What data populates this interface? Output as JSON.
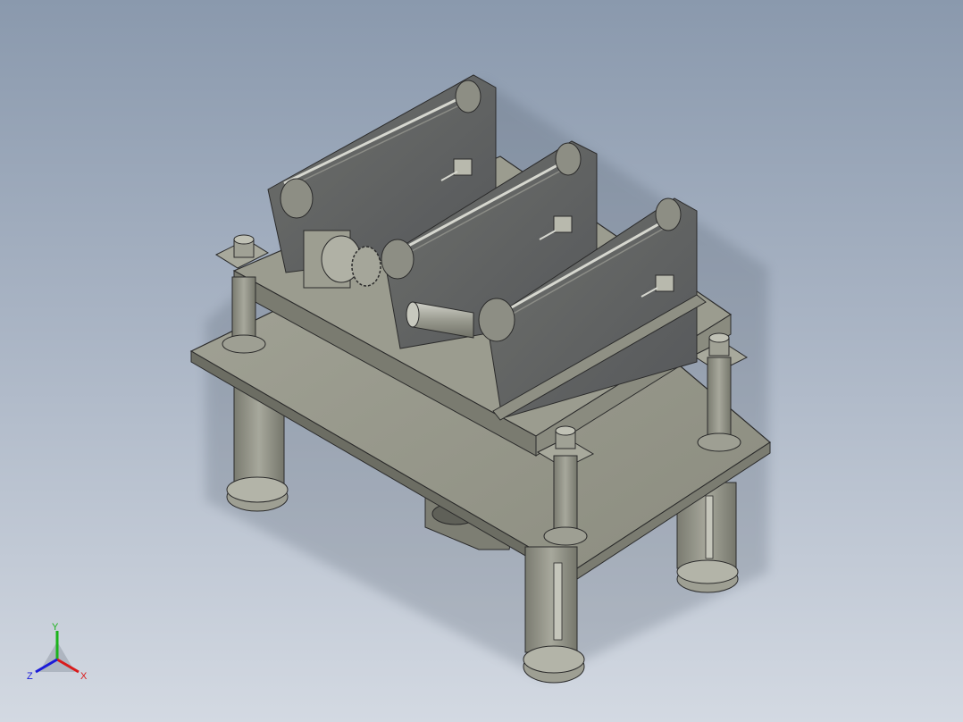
{
  "view": {
    "background_top": "#8a99ad",
    "background_bottom": "#d3d9e2",
    "part_fill": "#8e8f82",
    "part_edge": "#2b2b2b"
  },
  "triad": {
    "x_label": "X",
    "y_label": "Y",
    "z_label": "Z",
    "x_color": "#d91b1b",
    "y_color": "#1bb31b",
    "z_color": "#1b1bd9"
  }
}
